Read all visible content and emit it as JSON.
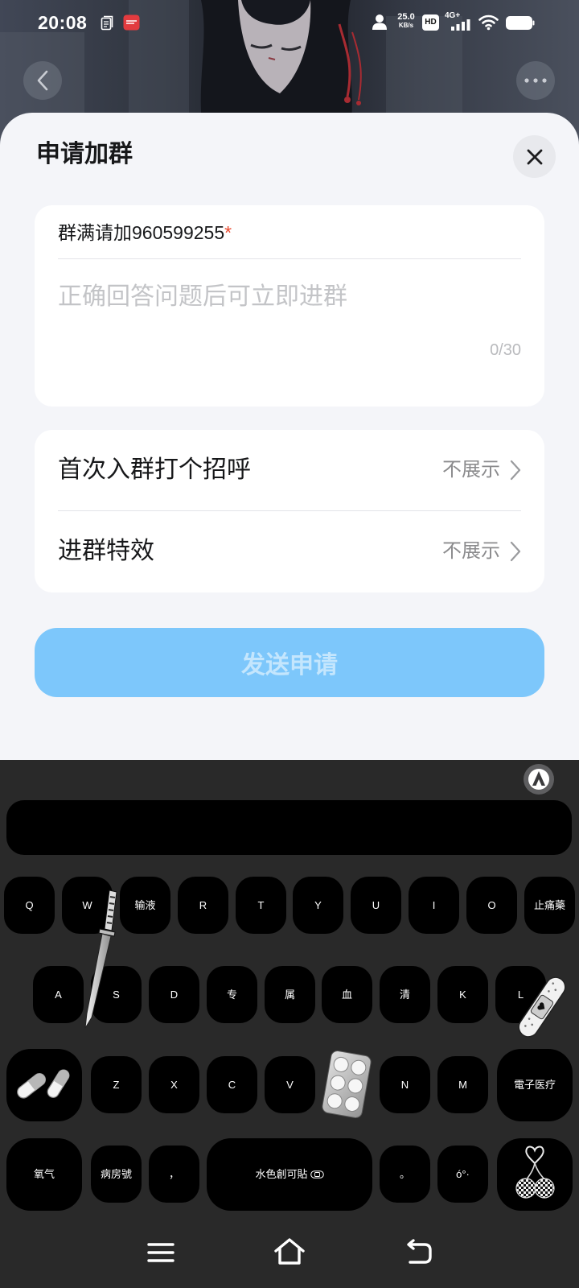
{
  "colors": {
    "cover_bg": "#272b36",
    "sheet_bg": "#f4f5f9",
    "card_bg": "#ffffff",
    "close_button_bg": "#e8e9ed",
    "accent_button": "#7dc7fb",
    "required_mark": "#ea4a2f",
    "text_primary": "#17181a",
    "text_secondary": "#8b8b8d",
    "placeholder": "#c3c4c7",
    "divider": "#e3e4e8",
    "keyboard_bg": "#292929",
    "key_bg": "#000000",
    "key_text": "#ffffff"
  },
  "status_bar": {
    "time": "20:08",
    "net_speed": "25.0",
    "net_speed_unit": "KB/s",
    "hd_badge": "HD",
    "network_type": "4G+",
    "icons": [
      "notes-icon",
      "app-notification-icon",
      "user-icon",
      "hd-icon",
      "signal-icon",
      "wifi-icon",
      "battery-icon"
    ]
  },
  "top_nav": {
    "back_icon": "chevron-left-icon",
    "more_icon": "more-dots-icon"
  },
  "dialog": {
    "title": "申请加群",
    "close_icon": "close-icon",
    "question": {
      "label": "群满请加960599255",
      "required_mark": "*",
      "placeholder": "正确回答问题后可立即进群",
      "counter": "0/30"
    },
    "settings": [
      {
        "label": "首次入群打个招呼",
        "value": "不展示",
        "icon": "chevron-right-icon"
      },
      {
        "label": "进群特效",
        "value": "不展示",
        "icon": "chevron-right-icon"
      }
    ],
    "submit_label": "发送申请",
    "submit_enabled": false
  },
  "keyboard": {
    "logo_icon": "keyboard-skin-logo-icon",
    "row1": [
      "Q",
      "W",
      "输液",
      "R",
      "T",
      "Y",
      "U",
      "I",
      "O",
      "止痛藥"
    ],
    "row2": [
      "A",
      "S",
      "D",
      "专",
      "属",
      "血",
      "清",
      "K",
      "L"
    ],
    "row3": [
      "Z",
      "X",
      "C",
      "V",
      "N",
      "M",
      "電子医疗"
    ],
    "row4": [
      "氧气",
      "病房號",
      "，",
      "水色創可貼",
      "。",
      "ó°·"
    ],
    "shift_icon": "capsule-pills-icon",
    "emoji_icon": "cherry-heart-icon",
    "space_icon": "bandage-icon",
    "stickers": [
      "knife-sticker",
      "bandage-sticker",
      "pill-blister-sticker"
    ]
  },
  "nav_bar": {
    "icons": [
      "menu-icon",
      "home-icon",
      "back-icon"
    ]
  }
}
